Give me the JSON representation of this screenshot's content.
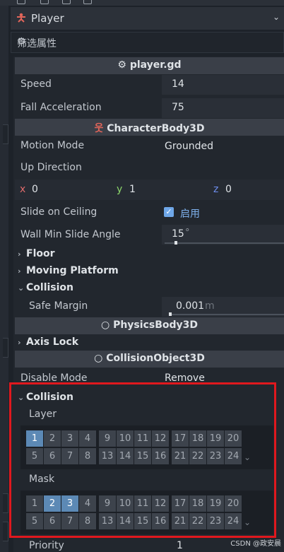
{
  "object": {
    "name": "Player",
    "type_icon": "character-body-icon"
  },
  "filter": {
    "placeholder": "筛选属性"
  },
  "script_section": {
    "title": "player.gd",
    "icon": "gear-icon"
  },
  "props": {
    "speed": {
      "label": "Speed",
      "value": "14"
    },
    "fall_accel": {
      "label": "Fall Acceleration",
      "value": "75"
    }
  },
  "character_section": {
    "title": "CharacterBody3D"
  },
  "character": {
    "motion_mode": {
      "label": "Motion Mode",
      "value": "Grounded"
    },
    "up_direction": {
      "label": "Up Direction",
      "x_label": "x",
      "x": "0",
      "y_label": "y",
      "y": "1",
      "z_label": "z",
      "z": "0"
    },
    "slide_on_ceiling": {
      "label": "Slide on Ceiling",
      "value": "启用",
      "checked": true
    },
    "wall_min_slide_angle": {
      "label": "Wall Min Slide Angle",
      "value": "15",
      "unit": "°"
    }
  },
  "groups": {
    "floor": "Floor",
    "moving_platform": "Moving Platform",
    "collision": "Collision",
    "axis_lock": "Axis Lock"
  },
  "safe_margin": {
    "label": "Safe Margin",
    "value": "0.001",
    "unit": "m"
  },
  "physics_section": {
    "title": "PhysicsBody3D"
  },
  "collision_object_section": {
    "title": "CollisionObject3D"
  },
  "disable_mode": {
    "label": "Disable Mode",
    "value": "Remove"
  },
  "collision_group": {
    "title": "Collision",
    "layer_label": "Layer",
    "mask_label": "Mask",
    "layer_on": [
      1
    ],
    "mask_on": [
      2,
      3
    ]
  },
  "priority": {
    "label": "Priority",
    "value": "1"
  },
  "watermark": "CSDN @政安晨",
  "colors": {
    "accent": "#5c89b5",
    "highlight_box": "#e0181e",
    "node_icon": "#e0655a"
  }
}
